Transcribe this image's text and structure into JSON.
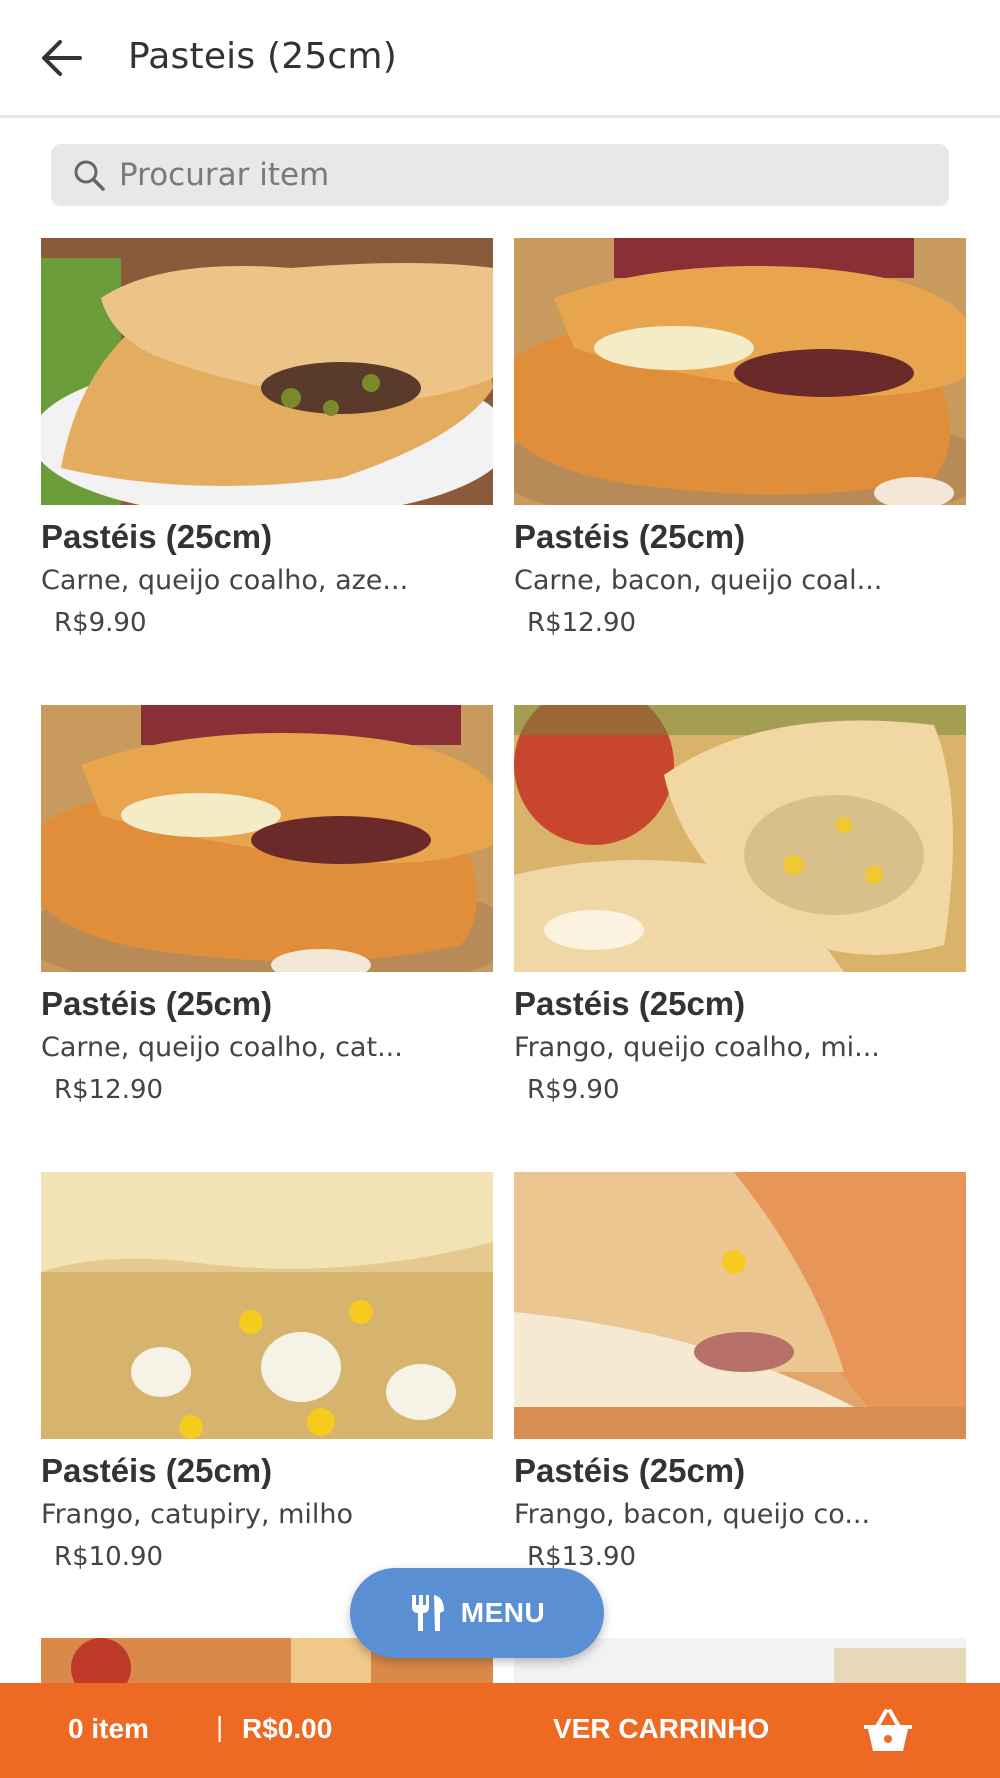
{
  "header": {
    "title": "Pasteis (25cm)",
    "back_icon": "arrow-left-icon"
  },
  "search": {
    "placeholder": "Procurar item",
    "icon": "search-icon"
  },
  "items": [
    {
      "name": "Pastéis (25cm)",
      "description": "Carne, queijo coalho, aze...",
      "price": "R$9.90"
    },
    {
      "name": "Pastéis (25cm)",
      "description": "Carne, bacon, queijo coal...",
      "price": "R$12.90"
    },
    {
      "name": "Pastéis (25cm)",
      "description": "Carne, queijo coalho, cat...",
      "price": "R$12.90"
    },
    {
      "name": "Pastéis (25cm)",
      "description": "Frango, queijo coalho, mi...",
      "price": "R$9.90"
    },
    {
      "name": "Pastéis (25cm)",
      "description": "Frango, catupiry, milho",
      "price": "R$10.90"
    },
    {
      "name": "Pastéis (25cm)",
      "description": "Frango, bacon, queijo co...",
      "price": "R$13.90"
    }
  ],
  "menu_button": {
    "label": "MENU",
    "icon": "fork-knife-icon"
  },
  "cart_bar": {
    "count": "0 item",
    "separator": "|",
    "total": "R$0.00",
    "cart_label": "VER CARRINHO",
    "cart_icon": "basket-icon"
  },
  "colors": {
    "accent_orange": "#ee6a23",
    "menu_blue": "#5b8fd3",
    "text_dark": "#333333"
  }
}
